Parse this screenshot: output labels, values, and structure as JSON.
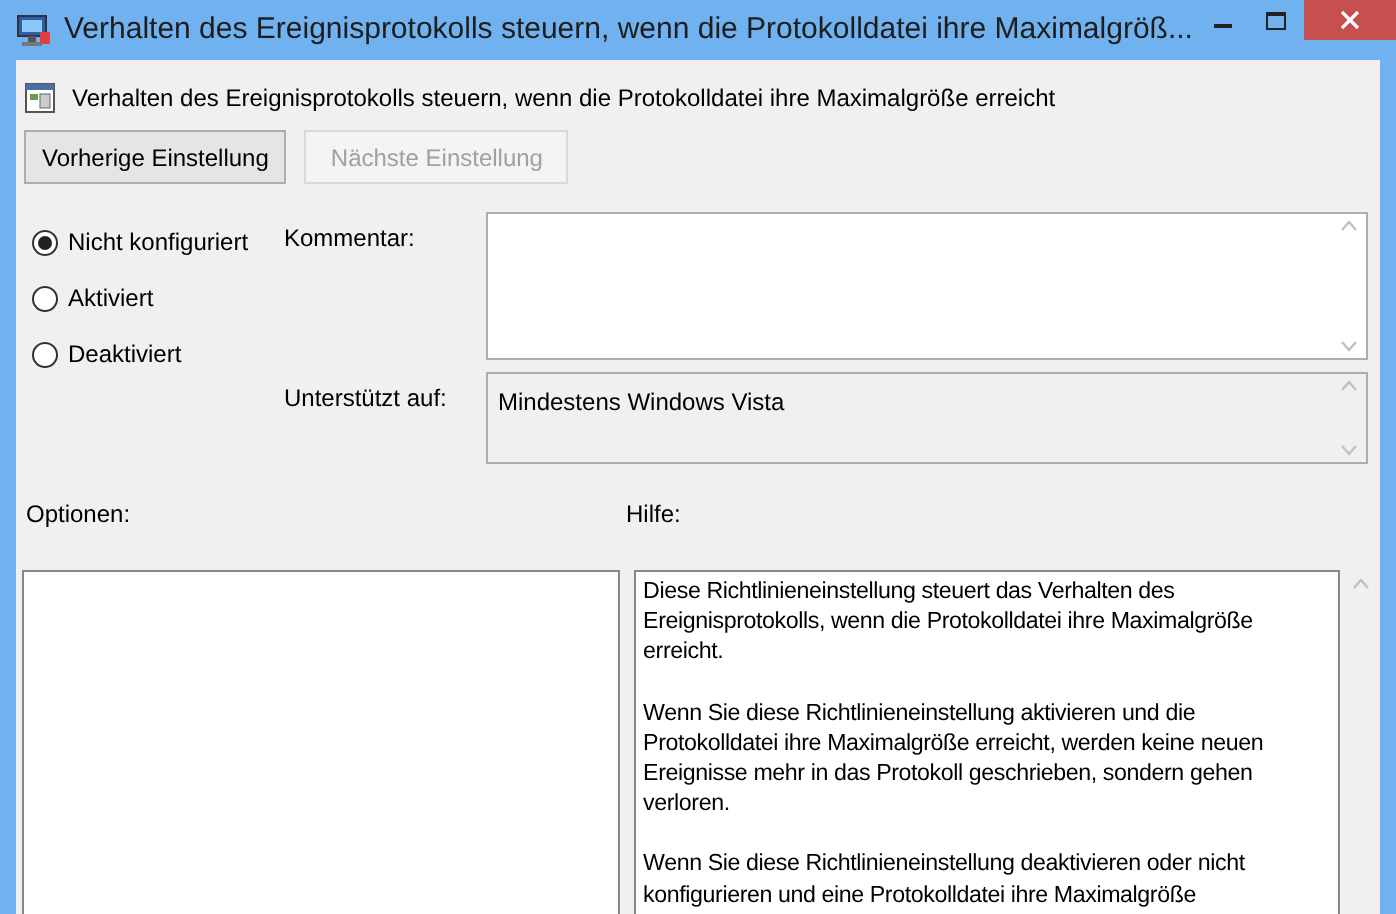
{
  "window": {
    "title": "Verhalten des Ereignisprotokolls steuern, wenn die Protokolldatei ihre Maximalgröß..."
  },
  "header": {
    "title": "Verhalten des Ereignisprotokolls steuern, wenn die Protokolldatei ihre Maximalgröße erreicht"
  },
  "nav_buttons": [
    {
      "label": "Vorherige Einstellung",
      "disabled": false
    },
    {
      "label": "Nächste Einstellung",
      "disabled": true
    }
  ],
  "state_options": [
    {
      "label": "Nicht konfiguriert",
      "selected": true
    },
    {
      "label": "Aktiviert",
      "selected": false
    },
    {
      "label": "Deaktiviert",
      "selected": false
    }
  ],
  "comment": {
    "label": "Kommentar:"
  },
  "supported_on": {
    "label": "Unterstützt auf:",
    "value": "Mindestens Windows Vista"
  },
  "options": {
    "label": "Optionen:"
  },
  "help": {
    "label": "Hilfe:",
    "paragraphs": [
      "Diese Richtlinieneinstellung steuert das Verhalten des Ereignisprotokolls, wenn die Protokolldatei ihre Maximalgröße erreicht.",
      "Wenn Sie diese Richtlinieneinstellung aktivieren und die Protokolldatei ihre Maximalgröße erreicht, werden keine neuen Ereignisse mehr in das Protokoll geschrieben, sondern gehen verloren.",
      "Wenn Sie diese Richtlinieneinstellung deaktivieren oder nicht konfigurieren und eine Protokolldatei ihre Maximalgröße"
    ]
  }
}
